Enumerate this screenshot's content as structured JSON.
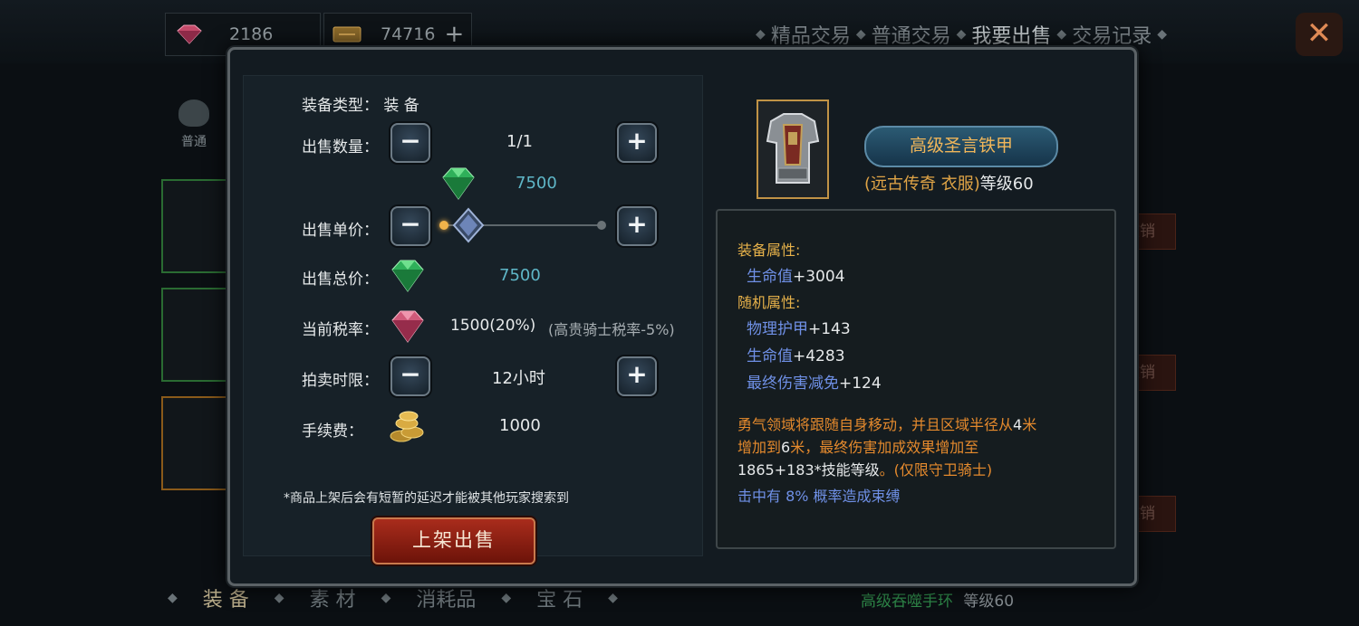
{
  "currencies": [
    {
      "icon": "red-gem-icon",
      "amount": "2186"
    },
    {
      "icon": "ticket-icon",
      "amount": "74716",
      "plus": "+"
    }
  ],
  "top_tabs": [
    "精品交易",
    "普通交易",
    "我要出售",
    "交易记录"
  ],
  "top_tab_active": "我要出售",
  "side_category": "普通",
  "bottom_tabs": [
    "装 备",
    "素 材",
    "消耗品",
    "宝 石"
  ],
  "bottom_item": {
    "name": "高级吞噬手环",
    "level": "等级60"
  },
  "cancel_label": "撤销",
  "form": {
    "type_label": "装备类型：",
    "type_value": "装 备",
    "qty_label": "出售数量：",
    "qty_value": "1/1",
    "price_top_value": "7500",
    "unit_price_label": "出售单价：",
    "total_label": "出售总价：",
    "total_value": "7500",
    "tax_label": "当前税率：",
    "tax_value": "1500(20%)",
    "tax_note": "(高贵骑士税率-5%)",
    "time_label": "拍卖时限：",
    "time_value": "12小时",
    "fee_label": "手续费：",
    "fee_value": "1000",
    "note": "*商品上架后会有短暂的延迟才能被其他玩家搜索到",
    "submit_label": "上架出售"
  },
  "item": {
    "name": "高级圣言铁甲",
    "quality": "(远古传奇 衣服)",
    "level": "等级60",
    "equip_attr_title": "装备属性:",
    "equip_attrs": [
      {
        "key": "生命值",
        "value": "+3004"
      }
    ],
    "random_attr_title": "随机属性:",
    "random_attrs": [
      {
        "key": "物理护甲",
        "value": "+143"
      },
      {
        "key": "生命值",
        "value": "+4283"
      },
      {
        "key": "最终伤害减免",
        "value": "+124"
      }
    ],
    "skill_text_1": "勇气领域将跟随自身移动，并且区域半径从",
    "skill_num_1": "4",
    "skill_text_2": "米增加到",
    "skill_num_2": "6",
    "skill_text_3": "米，最终伤害加成效果增加至",
    "skill_num_3": "1865+183*技能等级",
    "skill_text_4": "。(仅限守卫骑士)",
    "skill_line_2": "击中有 8% 概率造成束缚"
  },
  "colors": {
    "accent_gold": "#e6b14a",
    "attr_blue": "#6f90e6",
    "skill_orange": "#e58a2d",
    "total_teal": "#5fb7c8"
  }
}
